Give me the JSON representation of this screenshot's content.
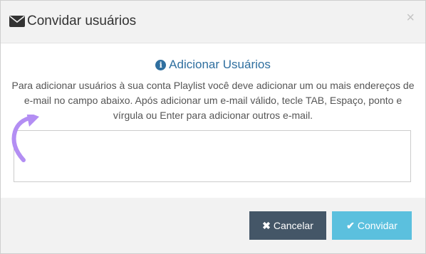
{
  "modal": {
    "title": "Convidar usuários",
    "close_label": "×"
  },
  "section": {
    "title": "Adicionar Usuários",
    "info_icon": "i"
  },
  "description": "Para adicionar usuários à sua conta Playlist você deve adicionar um ou mais endereços de e-mail no campo abaixo. Após adicionar um e-mail válido, tecle TAB, Espaço, ponto e vírgula ou Enter para adicionar outros e-mail.",
  "email_input": {
    "value": "",
    "placeholder": ""
  },
  "buttons": {
    "cancel_icon": "✖",
    "cancel_label": "Cancelar",
    "invite_icon": "✔",
    "invite_label": "Convidar"
  },
  "colors": {
    "title_blue": "#2f6f9f",
    "cancel_bg": "#445667",
    "invite_bg": "#5bc0de",
    "arrow": "#b38ef3"
  }
}
